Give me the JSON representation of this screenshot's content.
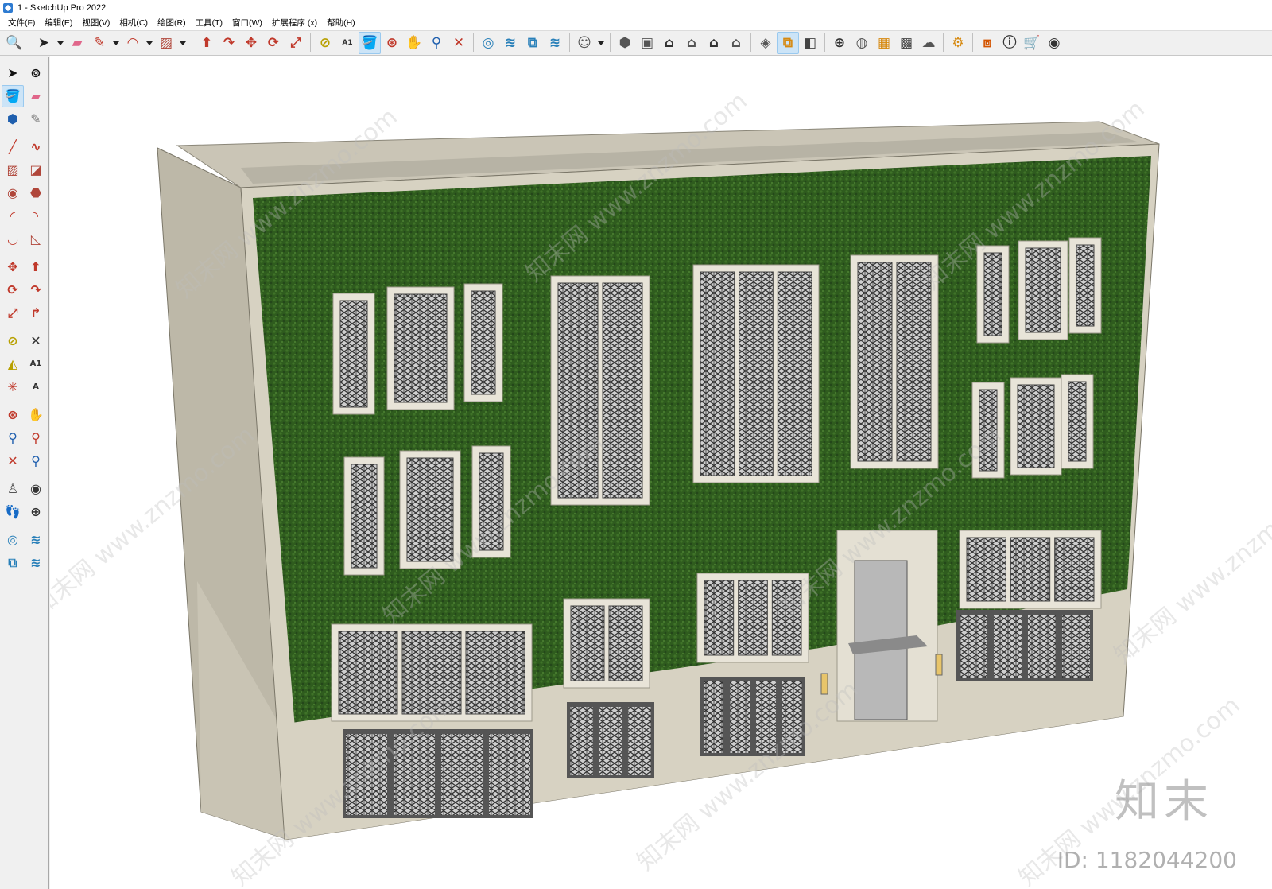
{
  "window": {
    "title": "1 - SketchUp Pro 2022"
  },
  "menu": [
    {
      "label": "文件(F)"
    },
    {
      "label": "编辑(E)"
    },
    {
      "label": "视图(V)"
    },
    {
      "label": "相机(C)"
    },
    {
      "label": "绘图(R)"
    },
    {
      "label": "工具(T)"
    },
    {
      "label": "窗口(W)"
    },
    {
      "label": "扩展程序 (x)"
    },
    {
      "label": "帮助(H)"
    }
  ],
  "toolbar": {
    "buttons": [
      {
        "name": "zoom-search-icon",
        "glyph": "🔍",
        "color": "#333"
      },
      {
        "name": "select-arrow-icon",
        "glyph": "➤",
        "color": "#222",
        "dropdown": true
      },
      {
        "name": "eraser-icon",
        "glyph": "▰",
        "color": "#e0668a"
      },
      {
        "name": "pencil-icon",
        "glyph": "✎",
        "color": "#c0392b",
        "dropdown": true
      },
      {
        "name": "arc-icon",
        "glyph": "◠",
        "color": "#c0392b",
        "dropdown": true
      },
      {
        "name": "rectangle-icon",
        "glyph": "▨",
        "color": "#b0463a",
        "dropdown": true
      },
      {
        "name": "push-pull-icon",
        "glyph": "⬆",
        "color": "#c0392b"
      },
      {
        "name": "follow-me-icon",
        "glyph": "↷",
        "color": "#c0392b"
      },
      {
        "name": "move-icon",
        "glyph": "✥",
        "color": "#c0392b"
      },
      {
        "name": "rotate-icon",
        "glyph": "⟳",
        "color": "#c0392b"
      },
      {
        "name": "scale-icon",
        "glyph": "⤢",
        "color": "#c0392b"
      },
      {
        "name": "tape-measure-icon",
        "glyph": "⊘",
        "color": "#b8a000"
      },
      {
        "name": "text-icon",
        "glyph": "A1",
        "color": "#333"
      },
      {
        "name": "paint-bucket-icon",
        "glyph": "🪣",
        "color": "#c08a00",
        "active": true
      },
      {
        "name": "orbit-icon",
        "glyph": "⊛",
        "color": "#c0392b"
      },
      {
        "name": "pan-icon",
        "glyph": "✋",
        "color": "#c08a00"
      },
      {
        "name": "zoom-icon",
        "glyph": "⚲",
        "color": "#1f5fae"
      },
      {
        "name": "zoom-extents-icon",
        "glyph": "✕",
        "color": "#c0392b"
      },
      {
        "name": "warehouse-icon",
        "glyph": "◎",
        "color": "#2980b9"
      },
      {
        "name": "extension-warehouse-icon",
        "glyph": "≋",
        "color": "#2980b9"
      },
      {
        "name": "layout-icon",
        "glyph": "⧉",
        "color": "#2980b9"
      },
      {
        "name": "style-builder-icon",
        "glyph": "≋",
        "color": "#2980b9"
      },
      {
        "name": "account-icon",
        "glyph": "☺",
        "color": "#555",
        "dropdown": true
      },
      {
        "name": "iso-view-icon",
        "glyph": "⬢",
        "color": "#555"
      },
      {
        "name": "top-view-icon",
        "glyph": "▣",
        "color": "#555"
      },
      {
        "name": "front-view-icon",
        "glyph": "⌂",
        "color": "#333"
      },
      {
        "name": "right-view-icon",
        "glyph": "⌂",
        "color": "#555"
      },
      {
        "name": "back-view-icon",
        "glyph": "⌂",
        "color": "#333"
      },
      {
        "name": "left-view-icon",
        "glyph": "⌂",
        "color": "#555"
      },
      {
        "name": "xray-style-icon",
        "glyph": "◈",
        "color": "#555"
      },
      {
        "name": "wireframe-style-icon",
        "glyph": "⧉",
        "color": "#d68910",
        "active": true
      },
      {
        "name": "shaded-style-icon",
        "glyph": "◧",
        "color": "#444"
      },
      {
        "name": "add-location-icon",
        "glyph": "⊕",
        "color": "#333"
      },
      {
        "name": "shadow-icon",
        "glyph": "◍",
        "color": "#555"
      },
      {
        "name": "terrain-icon",
        "glyph": "▦",
        "color": "#d68910"
      },
      {
        "name": "checker-icon",
        "glyph": "▩",
        "color": "#444"
      },
      {
        "name": "cloud-icon",
        "glyph": "☁",
        "color": "#555"
      },
      {
        "name": "settings-icon",
        "glyph": "⚙",
        "color": "#d68910"
      },
      {
        "name": "message-icon",
        "glyph": "⧈",
        "color": "#d35400"
      },
      {
        "name": "info-icon",
        "glyph": "ⓘ",
        "color": "#333"
      },
      {
        "name": "cart-icon",
        "glyph": "🛒",
        "color": "#333"
      },
      {
        "name": "profile-icon",
        "glyph": "◉",
        "color": "#333"
      }
    ]
  },
  "lefttools": [
    {
      "name": "select-icon",
      "glyph": "➤",
      "color": "#111"
    },
    {
      "name": "orbit-tool-icon",
      "glyph": "⊚",
      "color": "#111"
    },
    {
      "name": "paint-bucket-tool-icon",
      "glyph": "🪣",
      "color": "#c08a00",
      "active": true
    },
    {
      "name": "eraser-tool-icon",
      "glyph": "▰",
      "color": "#e0668a"
    },
    {
      "name": "component-icon",
      "glyph": "⬢",
      "color": "#1f5fae"
    },
    {
      "name": "tag-icon",
      "glyph": "✎",
      "color": "#777"
    },
    {
      "gap": true
    },
    {
      "name": "line-tool-icon",
      "glyph": "╱",
      "color": "#c0392b"
    },
    {
      "name": "freehand-tool-icon",
      "glyph": "∿",
      "color": "#c0392b"
    },
    {
      "name": "rectangle-tool-icon",
      "glyph": "▨",
      "color": "#b0463a"
    },
    {
      "name": "rotated-rectangle-tool-icon",
      "glyph": "◪",
      "color": "#b0463a"
    },
    {
      "name": "circle-tool-icon",
      "glyph": "◉",
      "color": "#b0463a"
    },
    {
      "name": "polygon-tool-icon",
      "glyph": "⬣",
      "color": "#b0463a"
    },
    {
      "name": "arc-tool-icon",
      "glyph": "◜",
      "color": "#c0392b"
    },
    {
      "name": "two-point-arc-tool-icon",
      "glyph": "◝",
      "color": "#c0392b"
    },
    {
      "name": "three-point-arc-tool-icon",
      "glyph": "◡",
      "color": "#c0392b"
    },
    {
      "name": "pie-tool-icon",
      "glyph": "◺",
      "color": "#b0463a"
    },
    {
      "gap": true
    },
    {
      "name": "move-tool-icon",
      "glyph": "✥",
      "color": "#c0392b"
    },
    {
      "name": "push-pull-tool-icon",
      "glyph": "⬆",
      "color": "#c0392b"
    },
    {
      "name": "rotate-tool-icon",
      "glyph": "⟳",
      "color": "#c0392b"
    },
    {
      "name": "follow-me-tool-icon",
      "glyph": "↷",
      "color": "#c0392b"
    },
    {
      "name": "scale-tool-icon",
      "glyph": "⤢",
      "color": "#c0392b"
    },
    {
      "name": "offset-tool-icon",
      "glyph": "↱",
      "color": "#c0392b"
    },
    {
      "gap": true
    },
    {
      "name": "tape-measure-tool-icon",
      "glyph": "⊘",
      "color": "#b8a000"
    },
    {
      "name": "dimension-tool-icon",
      "glyph": "✕",
      "color": "#333"
    },
    {
      "name": "protractor-tool-icon",
      "glyph": "◭",
      "color": "#b8a000"
    },
    {
      "name": "text-tool-icon",
      "glyph": "A1",
      "color": "#333"
    },
    {
      "name": "axes-tool-icon",
      "glyph": "✳",
      "color": "#c0392b"
    },
    {
      "name": "3d-text-tool-icon",
      "glyph": "A",
      "color": "#333"
    },
    {
      "gap": true
    },
    {
      "name": "orbit-nav-icon",
      "glyph": "⊛",
      "color": "#c0392b"
    },
    {
      "name": "pan-nav-icon",
      "glyph": "✋",
      "color": "#c08a00"
    },
    {
      "name": "zoom-nav-icon",
      "glyph": "⚲",
      "color": "#1f5fae"
    },
    {
      "name": "zoom-window-icon",
      "glyph": "⚲",
      "color": "#c0392b"
    },
    {
      "name": "zoom-extents-nav-icon",
      "glyph": "✕",
      "color": "#c0392b"
    },
    {
      "name": "previous-view-icon",
      "glyph": "⚲",
      "color": "#1f5fae"
    },
    {
      "gap": true
    },
    {
      "name": "position-camera-icon",
      "glyph": "♙",
      "color": "#555"
    },
    {
      "name": "look-around-icon",
      "glyph": "◉",
      "color": "#333"
    },
    {
      "name": "walk-icon",
      "glyph": "👣",
      "color": "#333"
    },
    {
      "name": "section-plane-icon",
      "glyph": "⊕",
      "color": "#333"
    },
    {
      "gap": true
    },
    {
      "name": "warehouse-tool-icon",
      "glyph": "◎",
      "color": "#2980b9"
    },
    {
      "name": "extension-tool-icon",
      "glyph": "≋",
      "color": "#2980b9"
    },
    {
      "name": "layout-tool-icon",
      "glyph": "⧉",
      "color": "#2980b9"
    },
    {
      "name": "style-tool-icon",
      "glyph": "≋",
      "color": "#2980b9"
    }
  ],
  "viewport": {
    "watermark_logo": "知末",
    "watermark_id": "ID: 1182044200",
    "watermark_site": "知末网 www.znzmo.com"
  },
  "colors": {
    "wall": "#d7d2c2",
    "wall_shadow": "#bdb8a8",
    "green_wall": "#2f5c1e",
    "window_frame": "#e8e4d8",
    "glass": "#b8b8b8",
    "door_frame": "#555555"
  }
}
